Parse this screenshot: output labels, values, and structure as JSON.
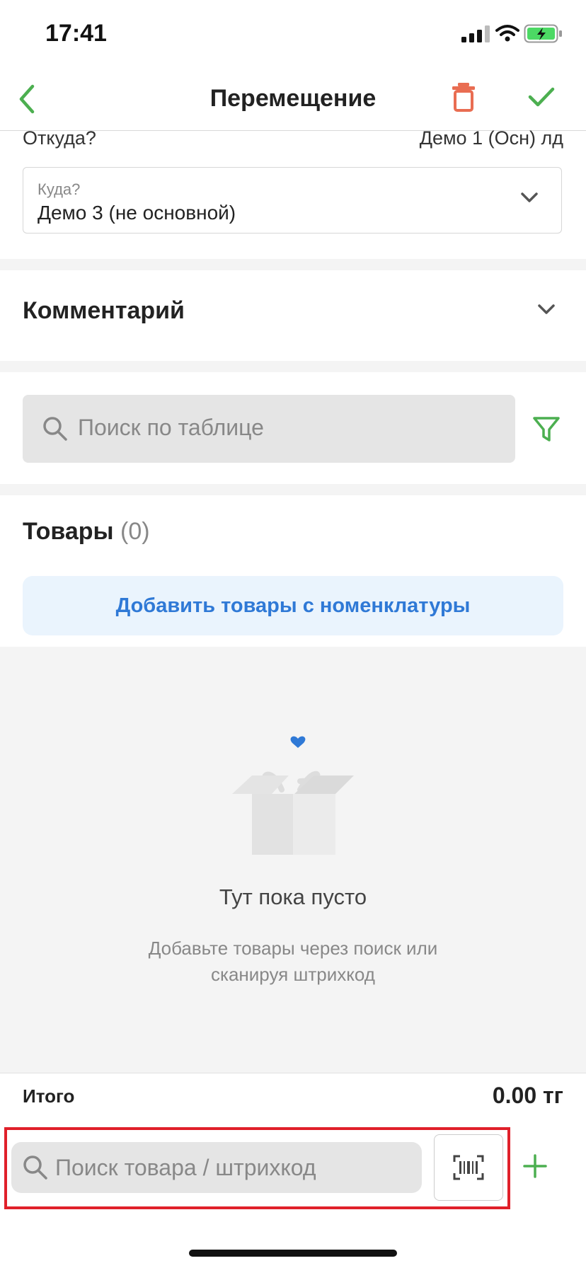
{
  "status_bar": {
    "time": "17:41"
  },
  "header": {
    "title": "Перемещение"
  },
  "from": {
    "label": "Откуда?",
    "value": "Демо 1 (Осн) лд"
  },
  "to": {
    "label": "Куда?",
    "value": "Демо 3 (не основной)"
  },
  "comment": {
    "title": "Комментарий"
  },
  "table_search": {
    "placeholder": "Поиск по таблице"
  },
  "goods": {
    "title": "Товары",
    "count": "(0)",
    "add_button": "Добавить товары с номенклатуры"
  },
  "empty_state": {
    "title": "Тут пока пусто",
    "subtitle": "Добавьте товары через поиск или сканируя штрихкод"
  },
  "total": {
    "label": "Итого",
    "value": "0.00 тг"
  },
  "product_search": {
    "placeholder": "Поиск товара / штрихкод"
  },
  "colors": {
    "accent_green": "#4caf50",
    "delete_red": "#e96d52",
    "link_blue": "#2f79d6",
    "highlight_red": "#e0202a"
  }
}
